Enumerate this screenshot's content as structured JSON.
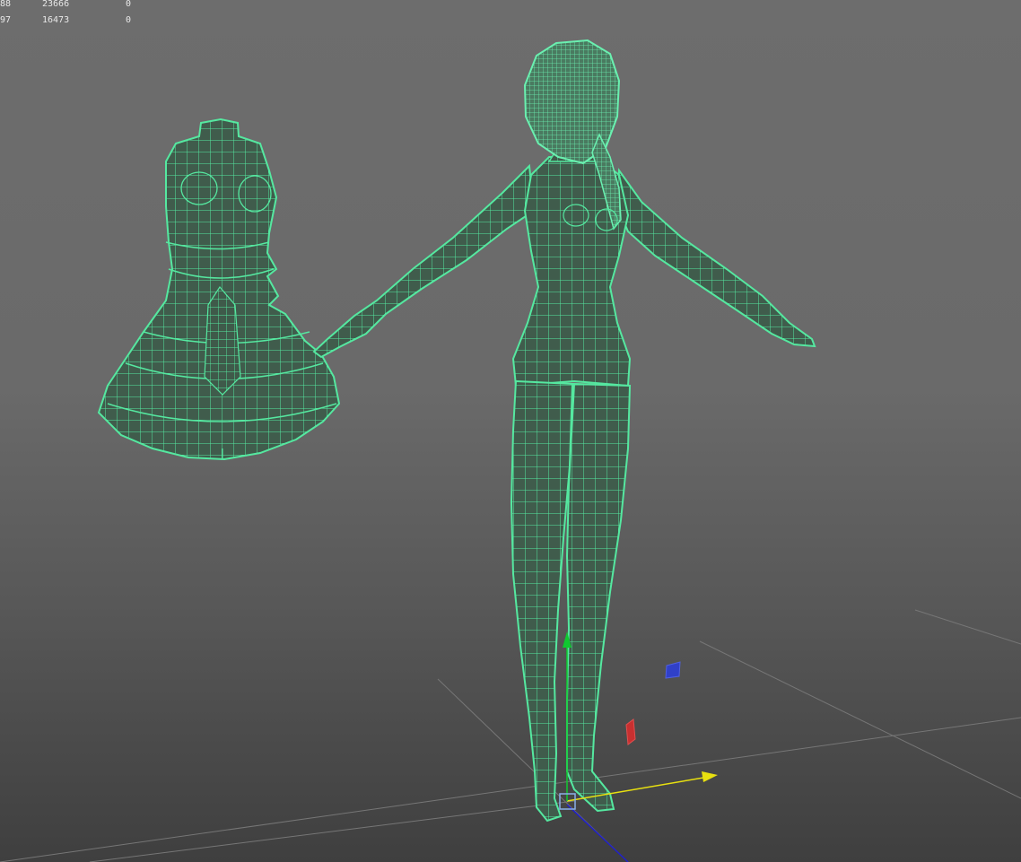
{
  "hud": {
    "rows": [
      {
        "a": "88",
        "b": "23666",
        "c": "0"
      },
      {
        "a": "97",
        "b": "16473",
        "c": "0"
      }
    ]
  },
  "scene": {
    "objects": [
      "dress-mesh",
      "character-body-mesh"
    ],
    "display_mode": "wireframe-on-shaded",
    "colors": {
      "wire": "#55e8a0",
      "shade": "#3f5a4a",
      "axis_x": "#e8e010",
      "axis_y": "#10c830",
      "axis_z": "#2020c8",
      "handle_red": "#c83030",
      "handle_blue": "#3040c8",
      "grid": "#7a7a7a"
    }
  }
}
